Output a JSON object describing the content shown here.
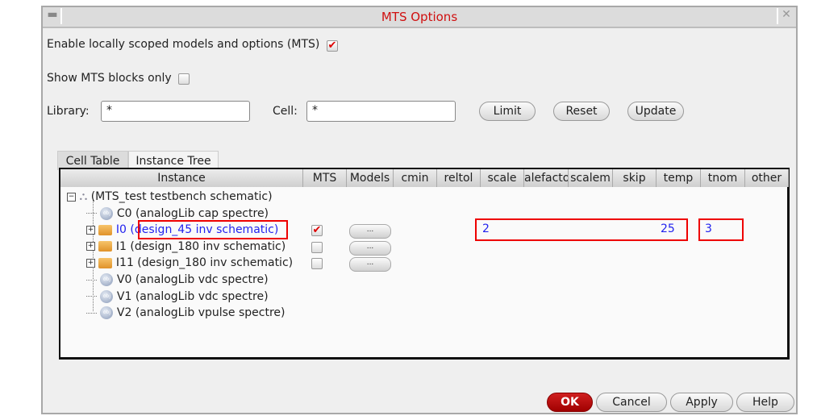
{
  "window": {
    "title": "MTS Options"
  },
  "options": {
    "enable_label": "Enable locally scoped models and options (MTS)",
    "enable_checked": true,
    "show_blocks_label": "Show MTS blocks only",
    "show_blocks_checked": false
  },
  "filters": {
    "library_label": "Library:",
    "library_value": "*",
    "cell_label": "Cell:",
    "cell_value": "*",
    "limit": "Limit",
    "reset": "Reset",
    "update": "Update"
  },
  "tabs": [
    {
      "label": "Cell Table"
    },
    {
      "label": "Instance Tree"
    }
  ],
  "columns": [
    "Instance",
    "MTS",
    "Models",
    "cmin",
    "reltol",
    "scale",
    "alefactor",
    "scalem",
    "skip",
    "temp",
    "tnom",
    "other"
  ],
  "rows": [
    {
      "label": "(MTS_test testbench schematic)",
      "icon": "hierarchy-icon",
      "expander": "−"
    },
    {
      "label": "C0 (analogLib cap spectre)",
      "icon": "object-icon"
    },
    {
      "name": "I0",
      "label": "(design_45 inv schematic)",
      "icon": "folder-icon",
      "expander": "+",
      "mts": true,
      "models": "...",
      "scale": "2",
      "temp": "25",
      "tnom": "3"
    },
    {
      "label": "I1 (design_180 inv schematic)",
      "icon": "folder-icon",
      "expander": "+",
      "mts": false,
      "models": "..."
    },
    {
      "label": "I11 (design_180 inv schematic)",
      "icon": "folder-icon",
      "expander": "+",
      "mts": false,
      "models": "..."
    },
    {
      "label": "V0 (analogLib vdc spectre)",
      "icon": "object-icon"
    },
    {
      "label": "V1 (analogLib vdc spectre)",
      "icon": "object-icon"
    },
    {
      "label": "V2 (analogLib vpulse spectre)",
      "icon": "object-icon"
    }
  ],
  "footer": {
    "ok": "OK",
    "cancel": "Cancel",
    "apply": "Apply",
    "help": "Help"
  }
}
